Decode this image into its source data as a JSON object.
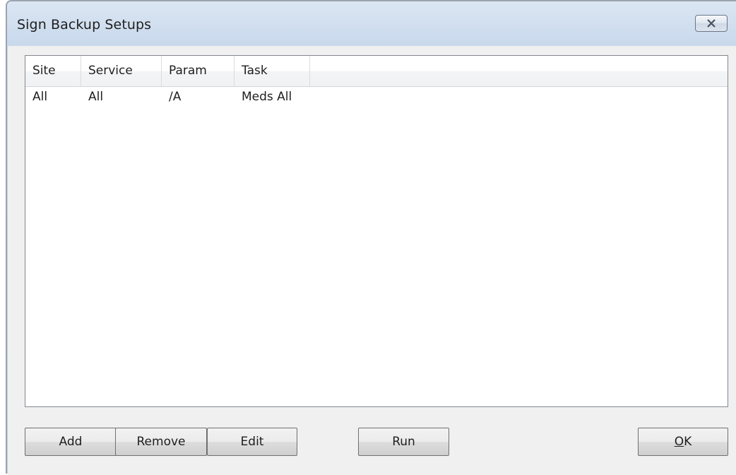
{
  "window": {
    "title": "Sign Backup Setups"
  },
  "listview": {
    "columns": [
      "Site",
      "Service",
      "Param",
      "Task"
    ],
    "rows": [
      {
        "site": "All",
        "service": "All",
        "param": "/A",
        "task": "Meds All"
      }
    ]
  },
  "buttons": {
    "add": "Add",
    "remove": "Remove",
    "edit": "Edit",
    "run": "Run",
    "ok_prefix": "O",
    "ok_suffix": "K"
  },
  "icons": {
    "close": "close-icon"
  }
}
